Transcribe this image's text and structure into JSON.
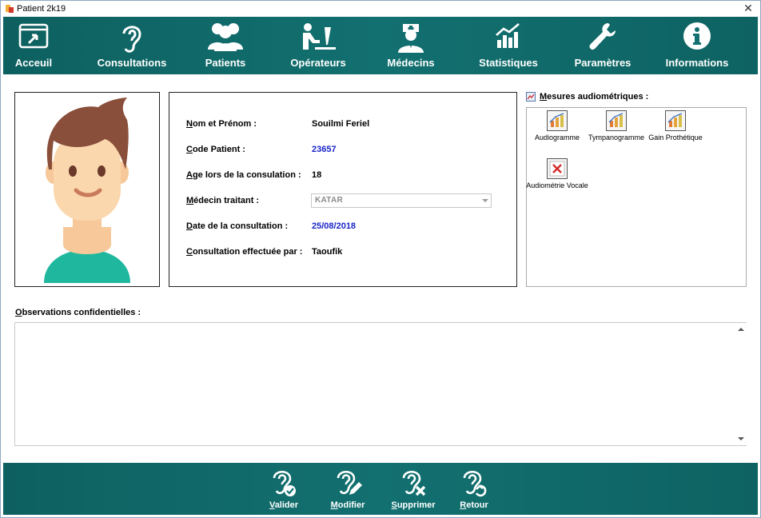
{
  "window": {
    "title": "Patient 2k19",
    "close_glyph": "✕"
  },
  "menu": [
    {
      "label": "Acceuil",
      "icon": "home-screen-icon"
    },
    {
      "label": "Consultations",
      "icon": "ear-icon"
    },
    {
      "label": "Patients",
      "icon": "users-icon"
    },
    {
      "label": "Opérateurs",
      "icon": "operator-desk-icon"
    },
    {
      "label": "Médecins",
      "icon": "doctor-icon"
    },
    {
      "label": "Statistiques",
      "icon": "chart-icon"
    },
    {
      "label": "Paramètres",
      "icon": "wrench-icon"
    },
    {
      "label": "Informations",
      "icon": "info-icon"
    }
  ],
  "patient": {
    "fields": [
      {
        "underline": "N",
        "rest": "om et Prénom :",
        "value": "Souilmi Feriel"
      },
      {
        "underline": "C",
        "rest": "ode Patient :",
        "value": "23657"
      },
      {
        "underline": "A",
        "rest": "ge lors de la consulation :",
        "value": "18"
      },
      {
        "underline": "M",
        "rest": "édecin traitant :",
        "value": "KATAR"
      },
      {
        "underline": "D",
        "rest": "ate de la consultation :",
        "value": "25/08/2018"
      },
      {
        "underline": "C",
        "rest": "onsultation effectuée par :",
        "value": "Taoufik"
      }
    ]
  },
  "mesures": {
    "title_underline": "M",
    "title_rest": "esures audiométriques :",
    "items": [
      {
        "label": "Audiogramme",
        "icon": "bar-chart-icon"
      },
      {
        "label": "Tympanogramme",
        "icon": "bar-chart-icon"
      },
      {
        "label": "Gain Prothétique",
        "icon": "bar-chart-icon"
      },
      {
        "label": "Audiométrie Vocale",
        "icon": "error-icon"
      }
    ]
  },
  "observations": {
    "label_underline": "O",
    "label_rest": "bservations confidentielles :",
    "value": ""
  },
  "actions": [
    {
      "underline": "V",
      "rest": "alider",
      "icon": "ear-check-icon"
    },
    {
      "underline": "M",
      "rest": "odifier",
      "icon": "ear-edit-icon"
    },
    {
      "underline": "S",
      "rest": "upprimer",
      "icon": "ear-delete-icon"
    },
    {
      "underline": "R",
      "rest": "etour",
      "icon": "ear-return-icon"
    }
  ],
  "colors": {
    "bar": "#137070",
    "link_value": "#1a25c8"
  }
}
